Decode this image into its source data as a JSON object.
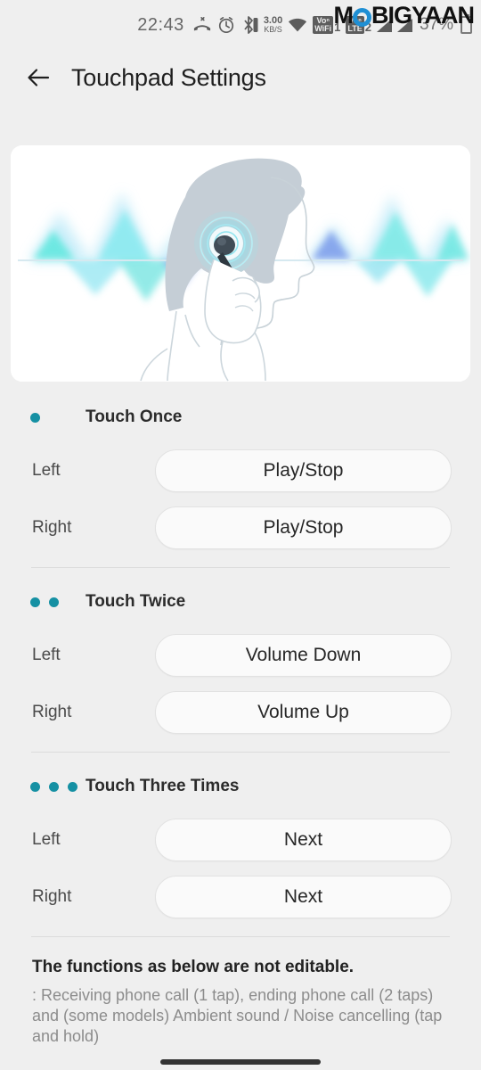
{
  "status_bar": {
    "time": "22:43",
    "icons": [
      "missed-call-icon",
      "alarm-icon",
      "bluetooth-icon"
    ],
    "network_speed": {
      "value": "3.00",
      "unit": "KB/S"
    },
    "wifi": "wifi-icon",
    "sim1": {
      "tag_top": "Voⁿ",
      "tag_bottom": "WiFi",
      "number": "1"
    },
    "sim2": {
      "tag_top": "Voⁿ",
      "tag_bottom": "LTE",
      "number": "2"
    },
    "battery_percent": "37%",
    "battery_icon": "battery-icon"
  },
  "watermark": {
    "part1": "M",
    "letter_o": "O",
    "part2": "BIGYAAN",
    "accent": "#1f8fd4"
  },
  "header": {
    "back_icon": "back-arrow-icon",
    "title": "Touchpad Settings"
  },
  "illustration": {
    "name": "earbud-touch-illustration",
    "description": "Person wearing earbud, touching it, with sound waves",
    "colors": {
      "hair": "#c3ccd4",
      "wave_cyan": "#6fe9e3",
      "wave_blue": "#7aa6f0",
      "earbud": "#3b4650"
    }
  },
  "theme": {
    "background": "#efefef",
    "card": "#ffffff",
    "accent_dot": "#1590a3",
    "pill_bg": "#fafafa",
    "pill_border": "#e2e2e2",
    "divider": "#dcdcdc"
  },
  "sections": [
    {
      "id": "touch-once",
      "title": "Touch Once",
      "dot_count": 1,
      "rows": [
        {
          "label": "Left",
          "value": "Play/Stop"
        },
        {
          "label": "Right",
          "value": "Play/Stop"
        }
      ]
    },
    {
      "id": "touch-twice",
      "title": "Touch Twice",
      "dot_count": 2,
      "rows": [
        {
          "label": "Left",
          "value": "Volume Down"
        },
        {
          "label": "Right",
          "value": "Volume Up"
        }
      ]
    },
    {
      "id": "touch-three-times",
      "title": "Touch Three Times",
      "dot_count": 3,
      "rows": [
        {
          "label": "Left",
          "value": "Next"
        },
        {
          "label": "Right",
          "value": "Next"
        }
      ]
    }
  ],
  "footer": {
    "title": "The functions as below are not editable.",
    "body": ": Receiving phone call (1 tap), ending phone call (2 taps) and (some models) Ambient sound / Noise cancelling (tap and hold)"
  }
}
